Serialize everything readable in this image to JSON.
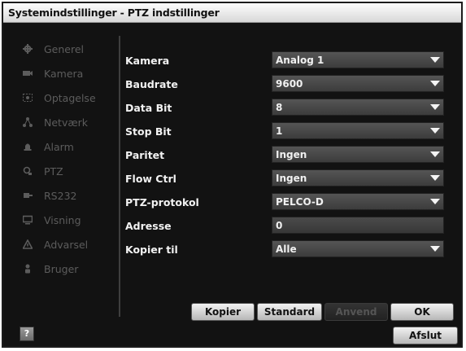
{
  "window": {
    "title": "Systemindstillinger - PTZ indstillinger"
  },
  "sidebar": {
    "items": [
      {
        "label": "Generel",
        "icon": "gear-icon"
      },
      {
        "label": "Kamera",
        "icon": "camera-icon"
      },
      {
        "label": "Optagelse",
        "icon": "record-icon"
      },
      {
        "label": "Netværk",
        "icon": "network-icon"
      },
      {
        "label": "Alarm",
        "icon": "alarm-icon"
      },
      {
        "label": "PTZ",
        "icon": "ptz-icon"
      },
      {
        "label": "RS232",
        "icon": "rs232-icon"
      },
      {
        "label": "Visning",
        "icon": "monitor-icon"
      },
      {
        "label": "Advarsel",
        "icon": "warning-icon"
      },
      {
        "label": "Bruger",
        "icon": "user-icon"
      }
    ]
  },
  "form": {
    "fields": [
      {
        "label": "Kamera",
        "value": "Analog 1",
        "type": "select"
      },
      {
        "label": "Baudrate",
        "value": "9600",
        "type": "select"
      },
      {
        "label": "Data Bit",
        "value": "8",
        "type": "select"
      },
      {
        "label": "Stop Bit",
        "value": "1",
        "type": "select"
      },
      {
        "label": "Paritet",
        "value": "Ingen",
        "type": "select"
      },
      {
        "label": "Flow Ctrl",
        "value": "Ingen",
        "type": "select"
      },
      {
        "label": "PTZ-protokol",
        "value": "PELCO-D",
        "type": "select"
      },
      {
        "label": "Adresse",
        "value": "0",
        "type": "input"
      },
      {
        "label": "Kopier til",
        "value": "Alle",
        "type": "select"
      }
    ]
  },
  "buttons": {
    "copy": "Kopier",
    "standard": "Standard",
    "apply": "Anvend",
    "ok": "OK",
    "exit": "Afslut",
    "help": "?"
  }
}
